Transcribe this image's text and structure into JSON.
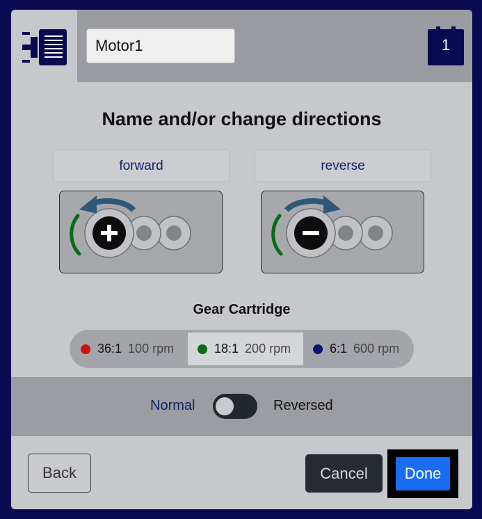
{
  "header": {
    "icon": "motor-icon",
    "motor_name": "Motor1",
    "port_number": "1"
  },
  "title": "Name and/or change directions",
  "directions": {
    "forward_label": "forward",
    "reverse_label": "reverse"
  },
  "gear_cartridge": {
    "title": "Gear Cartridge",
    "options": [
      {
        "ratio": "36:1",
        "rpm": "100 rpm",
        "color": "#d10f0f",
        "selected": false
      },
      {
        "ratio": "18:1",
        "rpm": "200 rpm",
        "color": "#0a6b14",
        "selected": true
      },
      {
        "ratio": "6:1",
        "rpm": "600 rpm",
        "color": "#0a137a",
        "selected": false
      }
    ]
  },
  "direction_toggle": {
    "normal_label": "Normal",
    "reversed_label": "Reversed",
    "reversed": false
  },
  "footer": {
    "back_label": "Back",
    "cancel_label": "Cancel",
    "done_label": "Done"
  },
  "colors": {
    "background": "#0a0a52",
    "accent": "#1a6cf3",
    "arrow": "#2f5878",
    "direction_arc": "#0a6b14"
  }
}
